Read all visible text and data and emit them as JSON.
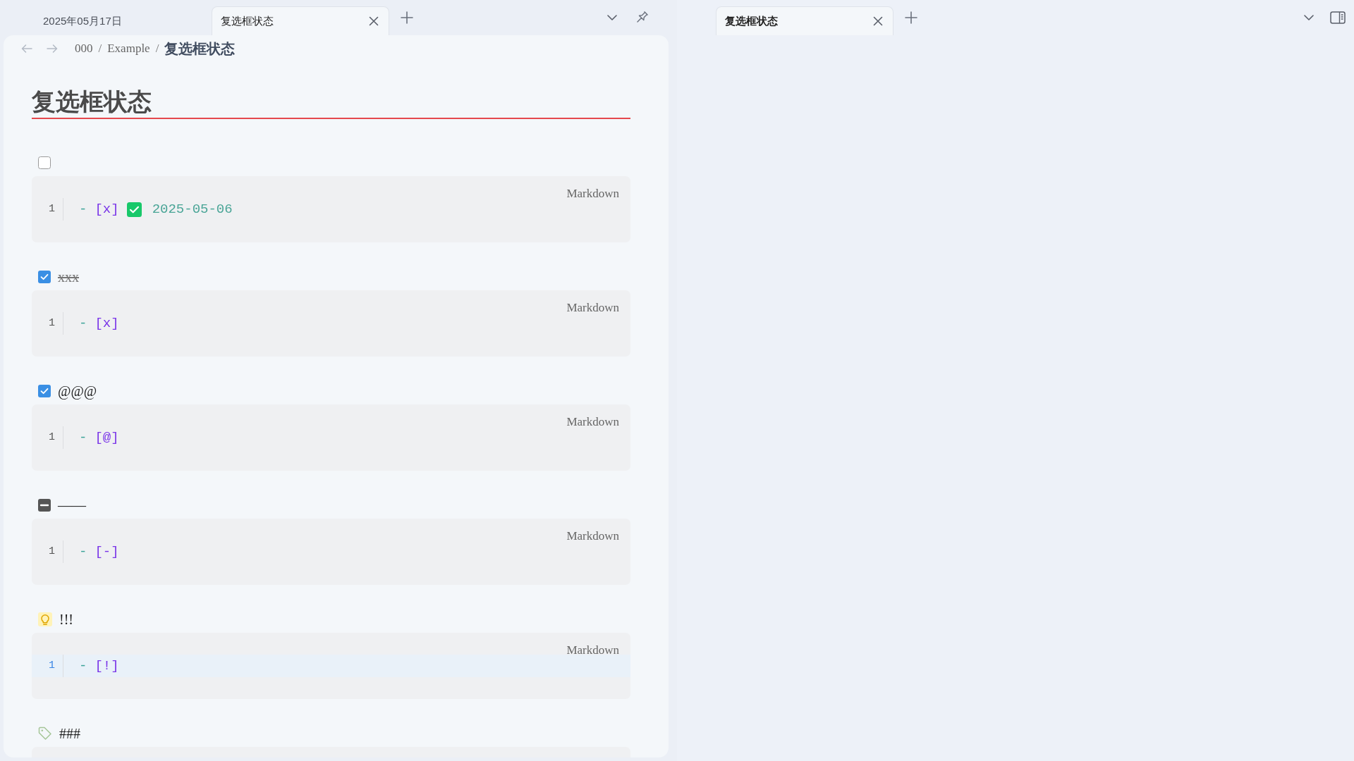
{
  "panes": [
    {
      "focused": false,
      "tabs": [
        {
          "label": "2025年05月17日",
          "selected": false
        },
        {
          "label": "复选框状态",
          "selected": true
        }
      ],
      "breadcrumb": [
        {
          "kind": "link",
          "text": "000"
        },
        {
          "kind": "separator",
          "text": "/"
        },
        {
          "kind": "link",
          "text": "Example"
        },
        {
          "kind": "separator",
          "text": "/"
        },
        {
          "kind": "current",
          "text": "复选框状态"
        }
      ],
      "note": {
        "title": "复选框状态",
        "blocks": [
          {
            "kind": "checkbox",
            "checked": false,
            "cancelled": false
          },
          {
            "kind": "code",
            "language": "Markdown",
            "lines": [
              {
                "number": "1",
                "active": false,
                "tokens": [
                  {
                    "kind": "dash",
                    "text": "-"
                  },
                  {
                    "kind": "task",
                    "text": "[x]"
                  },
                  {
                    "kind": "emoji"
                  },
                  {
                    "kind": "date",
                    "text": "2025-05-06"
                  }
                ]
              }
            ]
          },
          {
            "kind": "checkbox",
            "checked": true,
            "cancelled": false,
            "text": "xxx",
            "struck": true
          },
          {
            "kind": "code",
            "language": "Markdown",
            "lines": [
              {
                "number": "1",
                "active": false,
                "tokens": [
                  {
                    "kind": "dash",
                    "text": "-"
                  },
                  {
                    "kind": "task",
                    "text": "[x]"
                  }
                ]
              }
            ]
          },
          {
            "kind": "checkbox",
            "checked": true,
            "cancelled": false,
            "text": "@@@",
            "struck": false
          },
          {
            "kind": "code",
            "language": "Markdown",
            "lines": [
              {
                "number": "1",
                "active": false,
                "tokens": [
                  {
                    "kind": "dash",
                    "text": "-"
                  },
                  {
                    "kind": "task",
                    "text": "[@]"
                  }
                ]
              }
            ]
          },
          {
            "kind": "checkbox",
            "cancelled": true,
            "text": "——",
            "struck": false
          },
          {
            "kind": "code",
            "language": "Markdown",
            "lines": [
              {
                "number": "1",
                "active": false,
                "tokens": [
                  {
                    "kind": "dash",
                    "text": "-"
                  },
                  {
                    "kind": "task",
                    "text": "[-]"
                  }
                ]
              }
            ]
          },
          {
            "kind": "idea",
            "text": "!!!",
            "struck": false
          },
          {
            "kind": "code",
            "language": "Markdown",
            "lines": [
              {
                "number": "1",
                "active": true,
                "tokens": [
                  {
                    "kind": "dash",
                    "text": "-"
                  },
                  {
                    "kind": "task",
                    "text": "[!]"
                  }
                ]
              }
            ]
          },
          {
            "kind": "tag",
            "text": "###",
            "struck": false
          },
          {
            "kind": "code"
          }
        ]
      }
    },
    {
      "focused": true,
      "tabs": [
        {
          "label": "复选框状态",
          "selected": true
        }
      ]
    }
  ]
}
